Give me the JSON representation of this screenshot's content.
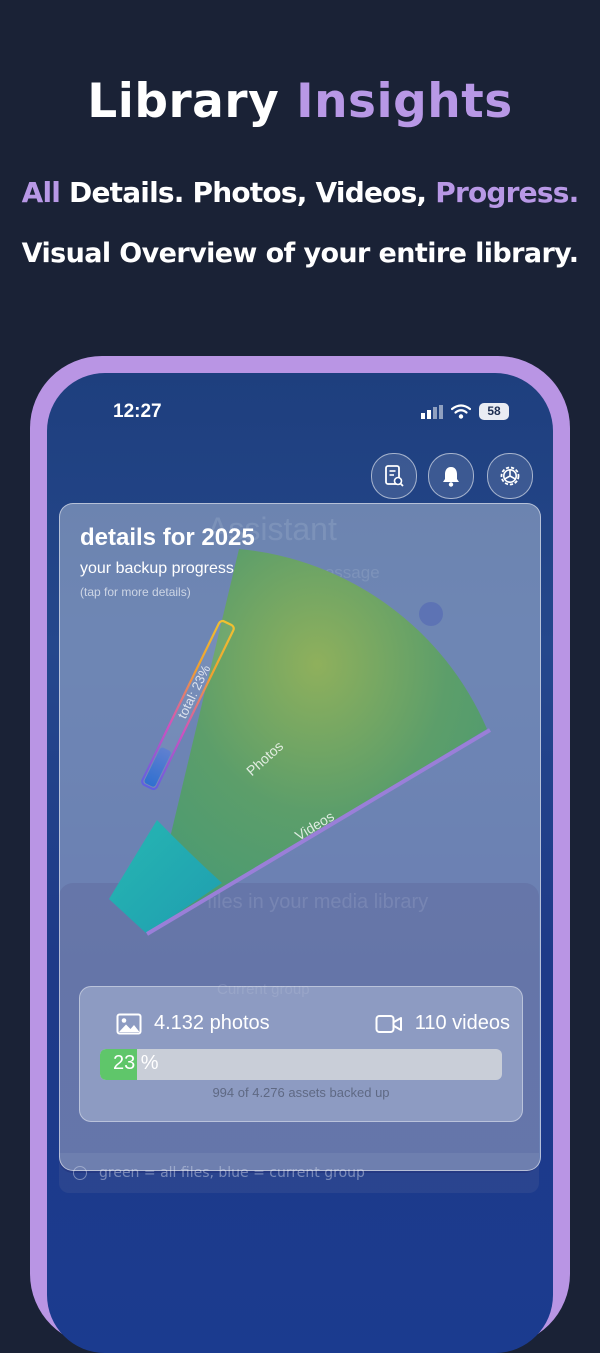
{
  "header": {
    "title_part1": "Library",
    "title_part2": "Insights",
    "subtitle_part1": "All",
    "subtitle_part2": "Details. Photos, Videos,",
    "subtitle_part3": "Progress.",
    "tagline": "Visual Overview of your entire library."
  },
  "colors": {
    "background": "#1a2236",
    "accent": "#b898e6",
    "phone_frame": "#b995e4",
    "photos_sector": "#5a9e6a",
    "videos_sector": "#1fb0b0",
    "progress_fill": "#5fc66a"
  },
  "status_bar": {
    "time": "12:27",
    "battery": "58",
    "icons": [
      "signal-icon",
      "wifi-icon",
      "battery-icon"
    ]
  },
  "toolbar": {
    "buttons": [
      {
        "name": "report-button",
        "icon": "report-search-icon"
      },
      {
        "name": "notifications-button",
        "icon": "bell-icon"
      },
      {
        "name": "settings-button",
        "icon": "gear-icon"
      }
    ]
  },
  "background_content": {
    "assistant": "Assistant",
    "message": "Assistant message",
    "library": "files in your media library",
    "group": "Current group"
  },
  "card": {
    "title": "details for 2025",
    "subtitle": "your backup progress",
    "hint": "(tap for more details)"
  },
  "chart_data": {
    "type": "pie",
    "slices": [
      {
        "label": "Photos",
        "value": 4132
      },
      {
        "label": "Videos",
        "value": 110
      }
    ],
    "total_label": "total: 23%",
    "total_percent": 23
  },
  "stats": {
    "photos": "4.132 photos",
    "videos": "110 videos",
    "progress_label": "23 %",
    "progress_percent": 23,
    "assets": "994 of 4.276 assets backed up"
  },
  "footnote": "green = all files, blue = current group"
}
